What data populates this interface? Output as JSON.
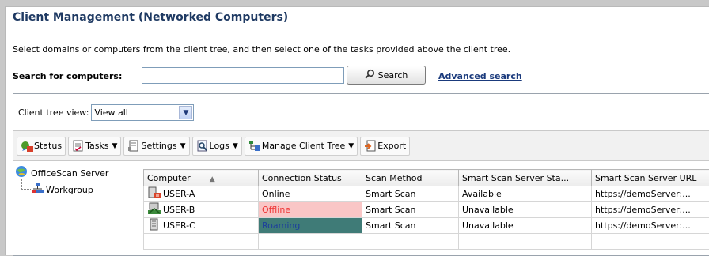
{
  "header": {
    "title": "Client Management (Networked Computers)",
    "description": "Select domains or computers from the client tree, and then select one of the tasks provided above the client tree."
  },
  "search": {
    "label": "Search for computers:",
    "value": "",
    "button_label": "Search",
    "advanced_label": "Advanced search"
  },
  "treeview": {
    "label": "Client tree view:",
    "selected": "View all"
  },
  "toolbar": {
    "status": "Status",
    "tasks": "Tasks",
    "settings": "Settings",
    "logs": "Logs",
    "manage_tree": "Manage Client Tree",
    "export": "Export"
  },
  "tree": {
    "root": "OfficeScan Server",
    "child": "Workgroup"
  },
  "grid": {
    "columns": [
      "Computer",
      "Connection Status",
      "Scan Method",
      "Smart Scan Server Sta...",
      "Smart Scan Server URL"
    ],
    "rows": [
      {
        "computer": "USER-A",
        "status": "Online",
        "scan_method": "Smart Scan",
        "server_status": "Available",
        "server_url": "https://demoServer:..."
      },
      {
        "computer": "USER-B",
        "status": "Offline",
        "scan_method": "Smart Scan",
        "server_status": "Unavailable",
        "server_url": "https://demoServer:..."
      },
      {
        "computer": "USER-C",
        "status": "Roaming",
        "scan_method": "Smart Scan",
        "server_status": "Unavailable",
        "server_url": "https://demoServer:..."
      }
    ]
  },
  "colors": {
    "title": "#1f3a63",
    "offline_bg": "#f9c6c6",
    "roaming_bg": "#3f7b77"
  },
  "icons": {
    "search": "magnifier-icon",
    "status": "status-icon",
    "tasks": "tasks-icon",
    "settings": "settings-icon",
    "logs": "logs-icon",
    "manage": "manage-tree-icon",
    "export": "export-icon",
    "server": "server-globe-icon",
    "workgroup": "workgroup-icon",
    "online_computer": "online-computer-icon",
    "offline_computer": "offline-computer-icon",
    "roaming_computer": "roaming-computer-icon"
  }
}
